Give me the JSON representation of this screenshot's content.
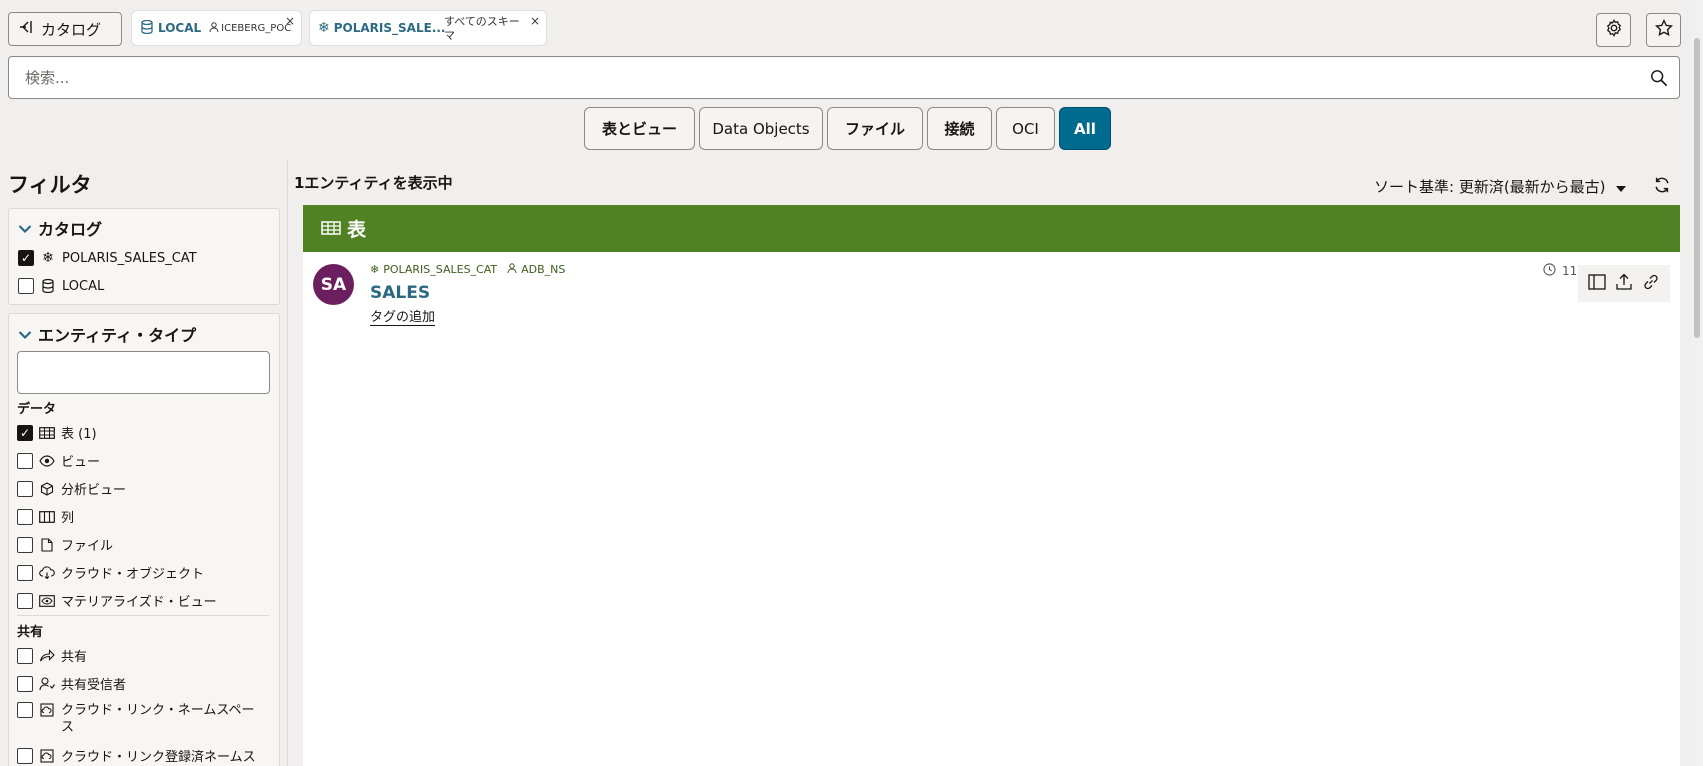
{
  "topbar": {
    "catalog_button": "カタログ",
    "tabs": [
      {
        "title": "LOCAL",
        "sub": "ICEBERG_POC",
        "close": "×"
      },
      {
        "title": "POLARIS_SALE...",
        "sub": "すべてのスキーマ",
        "close": "×"
      }
    ]
  },
  "search": {
    "placeholder": "検索..."
  },
  "segments": [
    "表とビュー",
    "Data Objects",
    "ファイル",
    "接続",
    "OCI",
    "All"
  ],
  "filter": {
    "title": "フィルタ",
    "catalog": {
      "heading": "カタログ",
      "items": [
        {
          "label": "POLARIS_SALES_CAT",
          "checked": true
        },
        {
          "label": "LOCAL",
          "checked": false
        }
      ]
    },
    "entity_type": {
      "heading": "エンティティ・タイプ",
      "input_value": "",
      "group_data": "データ",
      "data_items": [
        {
          "label": "表 (1)",
          "checked": true,
          "icon": "table-icon"
        },
        {
          "label": "ビュー",
          "checked": false,
          "icon": "eye-icon"
        },
        {
          "label": "分析ビュー",
          "checked": false,
          "icon": "cube-icon"
        },
        {
          "label": "列",
          "checked": false,
          "icon": "columns-icon"
        },
        {
          "label": "ファイル",
          "checked": false,
          "icon": "file-icon"
        },
        {
          "label": "クラウド・オブジェクト",
          "checked": false,
          "icon": "cloud-icon"
        },
        {
          "label": "マテリアライズド・ビュー",
          "checked": false,
          "icon": "materialized-view-icon"
        }
      ],
      "group_share": "共有",
      "share_items": [
        {
          "label": "共有",
          "checked": false,
          "icon": "share-icon"
        },
        {
          "label": "共有受信者",
          "checked": false,
          "icon": "recipient-icon"
        },
        {
          "label": "クラウド・リンク・ネームスペース",
          "checked": false,
          "icon": "cloud-link-icon"
        },
        {
          "label": "クラウド・リンク登録済ネームス",
          "checked": false,
          "icon": "cloud-link-registered-icon"
        }
      ]
    }
  },
  "results": {
    "count_text": "1エンティティを表示中",
    "sort_text": "ソート基準: 更新済(最新から最古)",
    "group_header": "表",
    "entity": {
      "avatar": "SA",
      "catalog": "POLARIS_SALES_CAT",
      "namespace": "ADB_NS",
      "name": "SALES",
      "add_tag": "タグの追加",
      "time": "11"
    }
  },
  "colors": {
    "accent": "#006b8f",
    "group_header": "#508223",
    "avatar": "#6b1f5e",
    "link": "#2b6a82"
  }
}
